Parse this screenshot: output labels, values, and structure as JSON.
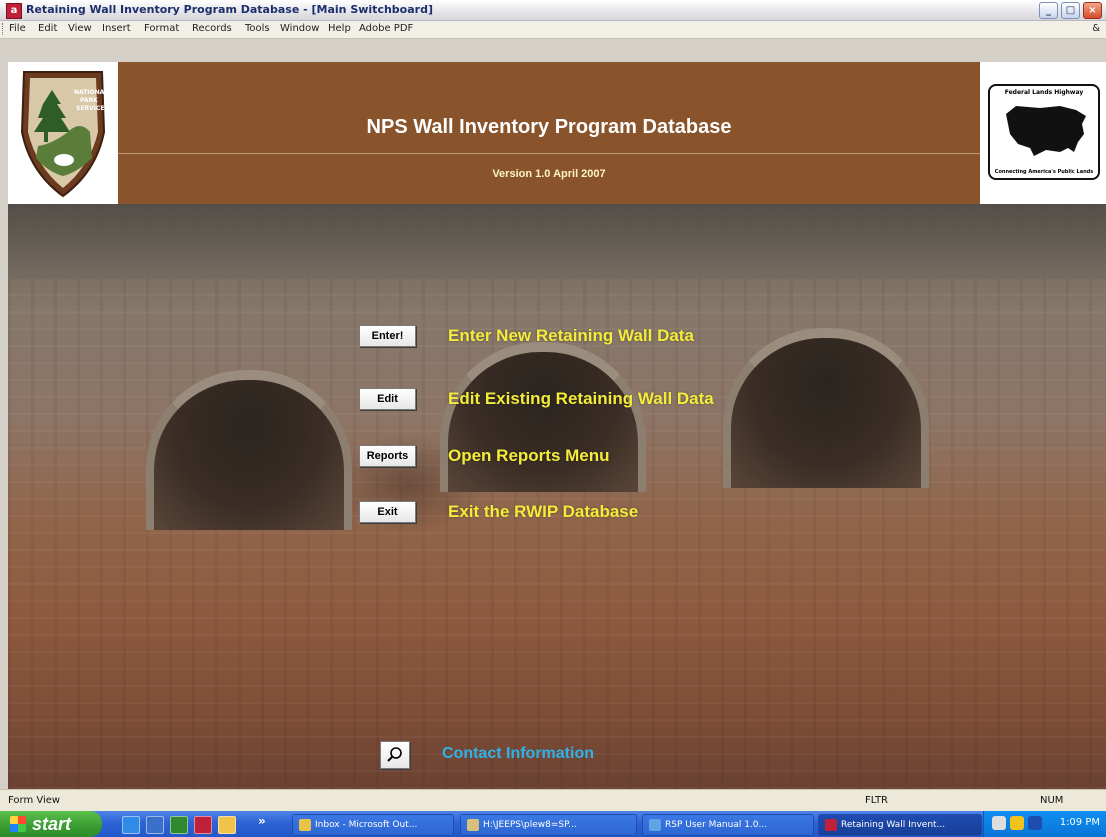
{
  "window": {
    "title": "Retaining Wall Inventory Program Database - [Main Switchboard]",
    "buttons": [
      "_",
      "□",
      "×"
    ]
  },
  "menubar": {
    "items": [
      "File",
      "Edit",
      "View",
      "Insert",
      "Format",
      "Records",
      "Tools",
      "Window",
      "Help",
      "Adobe PDF"
    ],
    "help_box": "&"
  },
  "header": {
    "title": "NPS Wall Inventory Program Database",
    "version": "Version 1.0    April 2007",
    "left_logo_alt": "NATIONAL PARK SERVICE",
    "right_logo_top": "Federal Lands Highway",
    "right_logo_bottom": "Connecting America's Public Lands",
    "logo_colors": {
      "brown": "#89532b",
      "tree": "#2f5d2a"
    }
  },
  "menu": [
    {
      "button": "Enter!",
      "label": "Enter New Retaining Wall Data"
    },
    {
      "button": "Edit",
      "label": "Edit Existing Retaining Wall  Data"
    },
    {
      "button": "Reports",
      "label": "Open Reports Menu"
    },
    {
      "button": "Exit",
      "label": "Exit the RWIP Database"
    }
  ],
  "contact": {
    "icon": "magnifier-icon",
    "label": "Contact Information"
  },
  "status": {
    "left": "Form View",
    "fltr": "FLTR",
    "num": "NUM"
  },
  "taskbar": {
    "start": "start",
    "quick_launch": [
      "ie-icon",
      "outlook-icon",
      "excel-icon",
      "access-icon",
      "folder-icon"
    ],
    "more": "»",
    "tasks": [
      {
        "label": "Inbox - Microsoft Out...",
        "icon_color": "#e8c34a"
      },
      {
        "label": "H:\\JEEPS\\plew8=SP...",
        "icon_color": "#d9c07a"
      },
      {
        "label": "RSP User Manual 1.0...",
        "icon_color": "#5fa5e6"
      },
      {
        "label": "Retaining Wall Invent...",
        "icon_color": "#c0213a"
      }
    ],
    "clock": "1:09 PM"
  }
}
